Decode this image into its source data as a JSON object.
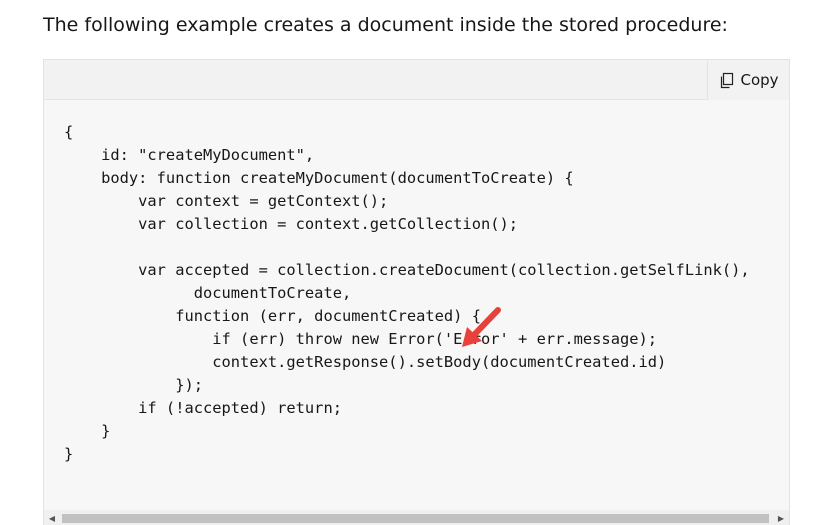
{
  "intro_text": "The following example creates a document inside the stored procedure:",
  "toolbar": {
    "copy_label": "Copy",
    "copy_icon": "copy-icon"
  },
  "code_lines": [
    "{",
    "    id: \"createMyDocument\",",
    "    body: function createMyDocument(documentToCreate) {",
    "        var context = getContext();",
    "        var collection = context.getCollection();",
    "",
    "        var accepted = collection.createDocument(collection.getSelfLink(),",
    "              documentToCreate,",
    "            function (err, documentCreated) {",
    "                if (err) throw new Error('Error' + err.message);",
    "                context.getResponse().setBody(documentCreated.id)",
    "            });",
    "        if (!accepted) return;",
    "    }",
    "}"
  ],
  "colors": {
    "code_background": "#f7f7f7",
    "header_background": "#f2f2f2",
    "annotation_arrow": "#e8403a"
  },
  "icons": {
    "scroll_left": "◀",
    "scroll_right": "▶"
  }
}
